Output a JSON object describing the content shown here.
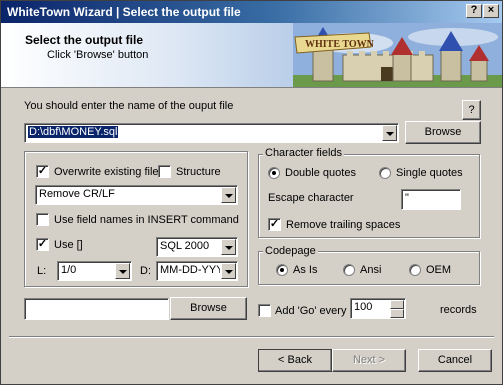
{
  "window": {
    "title": "WhiteTown Wizard | Select the output file"
  },
  "header": {
    "title": "Select the output file",
    "subtitle": "Click 'Browse' button",
    "logo_text": "WHITE TOWN"
  },
  "output": {
    "prompt": "You should enter the name of the ouput file",
    "help_label": "?",
    "path": "D:\\dbf\\MONEY.sql",
    "browse_label": "Browse"
  },
  "options": {
    "overwrite_label": "Overwrite existing file",
    "overwrite_checked": true,
    "structure_label": "Structure",
    "structure_checked": false,
    "line_end_value": "Remove CR/LF",
    "field_names_label": "Use field names in INSERT command",
    "field_names_checked": false,
    "use_brackets_label": "Use []",
    "use_brackets_checked": true,
    "sql_version": "SQL 2000",
    "l_label": "L:",
    "l_value": "1/0",
    "d_label": "D:",
    "d_value": "MM-DD-YYYY"
  },
  "char_fields": {
    "legend": "Character fields",
    "double_quotes_label": "Double quotes",
    "single_quotes_label": "Single quotes",
    "selected": "double",
    "escape_label": "Escape character",
    "escape_value": "\"",
    "trailing_label": "Remove trailing spaces",
    "trailing_checked": true
  },
  "codepage": {
    "legend": "Codepage",
    "as_is_label": "As Is",
    "ansi_label": "Ansi",
    "oem_label": "OEM",
    "selected": "as_is"
  },
  "bottom": {
    "file_value": "",
    "browse_label": "Browse",
    "add_go_label": "Add 'Go' every",
    "add_go_checked": false,
    "records_value": "100",
    "records_label": "records"
  },
  "nav": {
    "back_label": "< Back",
    "next_label": "Next >",
    "cancel_label": "Cancel"
  }
}
